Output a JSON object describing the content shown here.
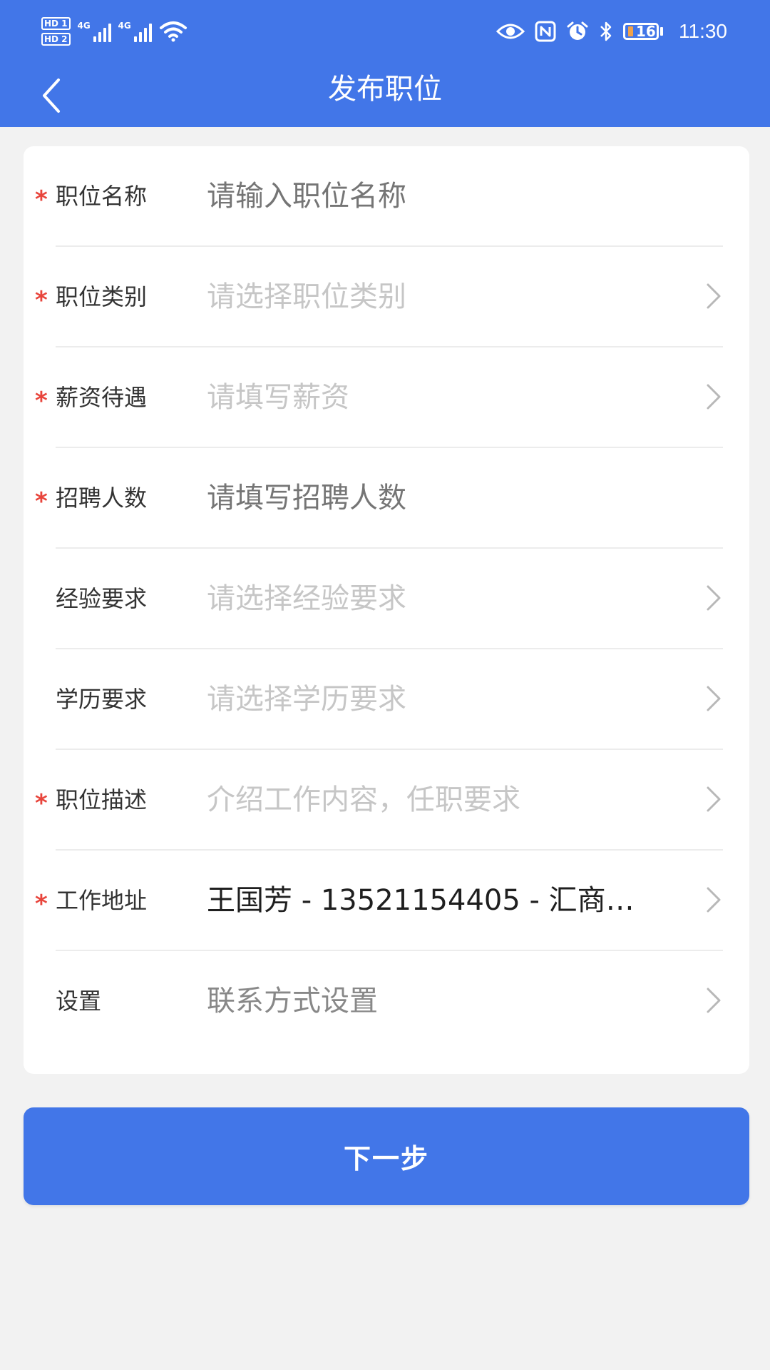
{
  "colors": {
    "primary": "#4276e8",
    "required": "#e8453c",
    "placeholder": "#c6c6c6",
    "label": "#333333",
    "background": "#f2f2f2"
  },
  "status_bar": {
    "hd1": "HD 1",
    "hd2": "HD 2",
    "net1": "4G",
    "net2": "4G",
    "battery": "16",
    "time": "11:30",
    "icons": [
      "eye-comfort-icon",
      "nfc-icon",
      "alarm-icon",
      "bluetooth-icon",
      "battery-icon"
    ]
  },
  "header": {
    "title": "发布职位",
    "back_icon": "back-arrow-icon"
  },
  "form": {
    "fields": [
      {
        "label": "职位名称",
        "required": true,
        "placeholder": "请输入职位名称",
        "type": "input"
      },
      {
        "label": "职位类别",
        "required": true,
        "placeholder": "请选择职位类别",
        "type": "select"
      },
      {
        "label": "薪资待遇",
        "required": true,
        "placeholder": "请填写薪资",
        "type": "select"
      },
      {
        "label": "招聘人数",
        "required": true,
        "placeholder": "请填写招聘人数",
        "type": "input"
      },
      {
        "label": "经验要求",
        "required": false,
        "placeholder": "请选择经验要求",
        "type": "select"
      },
      {
        "label": "学历要求",
        "required": false,
        "placeholder": "请选择学历要求",
        "type": "select"
      },
      {
        "label": "职位描述",
        "required": true,
        "placeholder": "介绍工作内容，任职要求",
        "type": "select"
      },
      {
        "label": "工作地址",
        "required": true,
        "value": "王国芳 - 13521154405 - 汇商…",
        "type": "select"
      },
      {
        "label": "设置",
        "required": false,
        "value": "联系方式设置",
        "type": "select"
      }
    ],
    "required_mark": "*"
  },
  "actions": {
    "next_label": "下一步"
  }
}
